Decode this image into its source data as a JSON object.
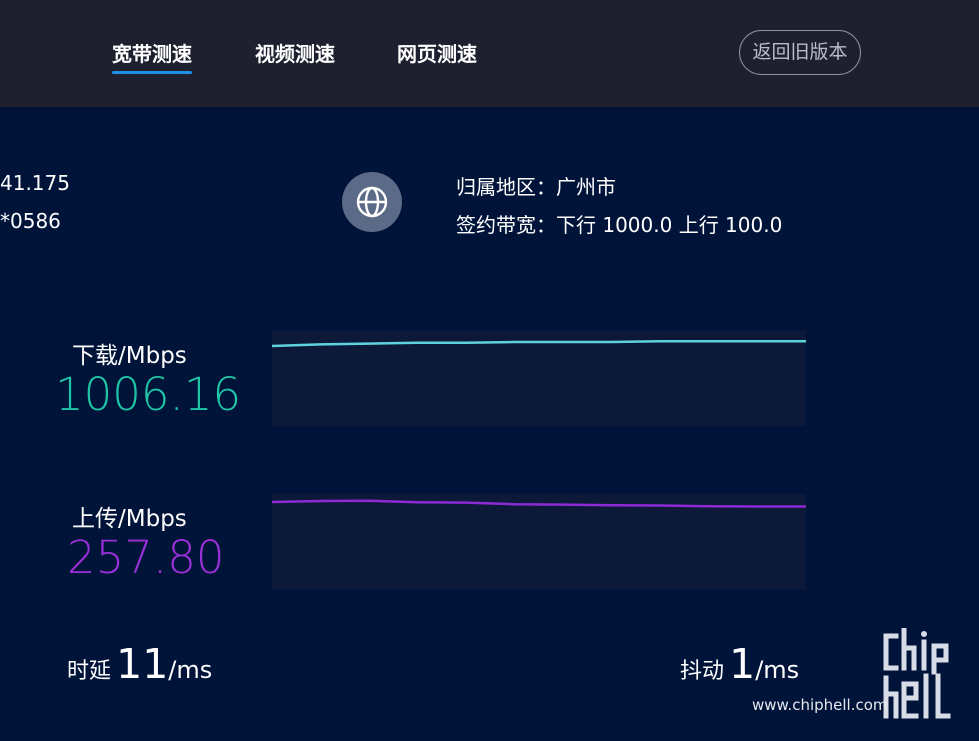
{
  "nav": {
    "tabs": [
      {
        "label": "宽带测速",
        "active": true
      },
      {
        "label": "视频测速",
        "active": false
      },
      {
        "label": "网页测速",
        "active": false
      }
    ],
    "old_version_label": "返回旧版本"
  },
  "info": {
    "ip_partial": "41.175",
    "account_partial": "*0586",
    "region_label": "归属地区：",
    "region_value": "广州市",
    "bandwidth_label": "签约带宽：",
    "bandwidth_value": "下行 1000.0 上行 100.0"
  },
  "download": {
    "label": "下载/Mbps",
    "value": "1006.16",
    "color": "#1fc6a6",
    "line_color": "#5fd3dd"
  },
  "upload": {
    "label": "上传/Mbps",
    "value": "257.80",
    "color": "#9b2fd8",
    "line_color": "#8d2ad6"
  },
  "latency": {
    "label": "时延",
    "value": "11",
    "unit": "/ms"
  },
  "jitter": {
    "label": "抖动",
    "value": "1",
    "unit": "/ms"
  },
  "watermark": {
    "text": "www.chiphell.com"
  },
  "chart_data": [
    {
      "type": "line",
      "name": "download",
      "y": [
        1000,
        1002,
        1003,
        1004,
        1004,
        1005,
        1005,
        1005,
        1006,
        1006,
        1006,
        1006
      ],
      "ylim": [
        900,
        1020
      ]
    },
    {
      "type": "line",
      "name": "upload",
      "y": [
        275,
        278,
        279,
        274,
        273,
        268,
        267,
        265,
        264,
        262,
        261,
        261
      ],
      "ylim": [
        0,
        300
      ]
    }
  ]
}
